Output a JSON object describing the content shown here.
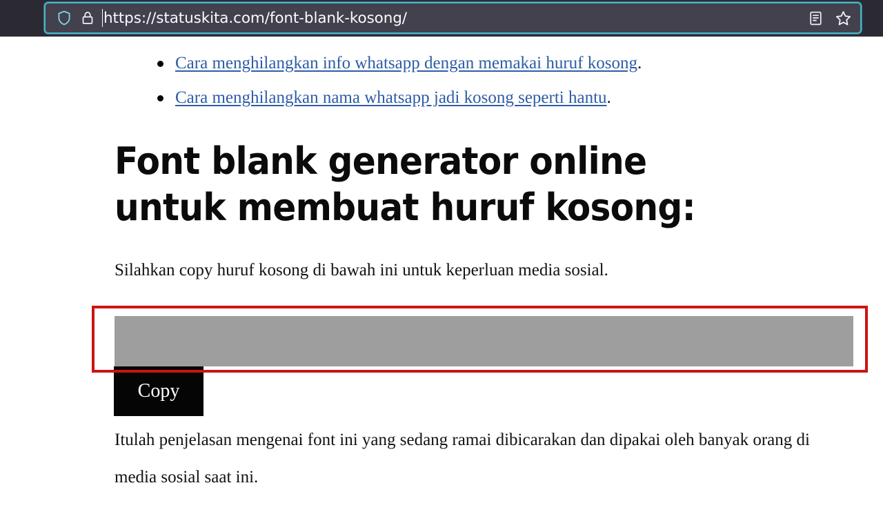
{
  "browser": {
    "url": "https://statuskita.com/font-blank-kosong/",
    "shield_icon": "shield-icon",
    "lock_icon": "padlock-icon",
    "reader_icon": "reader-view-icon",
    "bookmark_icon": "star-bookmark-icon",
    "chrome_color": "#2b2a33",
    "urlbar_color": "#42414d",
    "focus_ring_color": "#45b6c8"
  },
  "page": {
    "link_list": [
      {
        "text": "Cara menghilangkan info whatsapp dengan memakai huruf kosong",
        "suffix": "."
      },
      {
        "text": "Cara menghilangkan nama whatsapp jadi kosong seperti hantu",
        "suffix": "."
      }
    ],
    "link_color": "#2d5ca6",
    "title": "Font blank generator online untuk membuat huruf kosong:",
    "intro": "Silahkan copy huruf kosong di bawah ini untuk keperluan media sosial.",
    "blank_field": {
      "value": "ᅠ",
      "placeholder": "",
      "background_color": "#9e9e9e",
      "state": "selected"
    },
    "highlight_color": "#cc1414",
    "copy_button_label": "Copy",
    "outro": "Itulah penjelasan mengenai font ini yang sedang ramai dibicarakan dan dipakai oleh banyak orang di media sosial saat ini."
  }
}
